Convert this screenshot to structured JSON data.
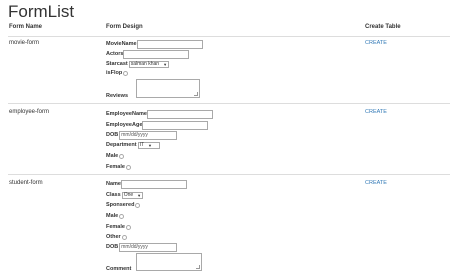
{
  "page": {
    "title": "FormList"
  },
  "table": {
    "headers": {
      "name": "Form Name",
      "design": "Form Design",
      "create": "Create Table"
    }
  },
  "forms": {
    "movie": {
      "name": "movie-form",
      "create_label": "CREATE",
      "fields": {
        "moviename": {
          "label": "MovieName"
        },
        "actors": {
          "label": "Actors"
        },
        "starcast": {
          "label": "Starcast",
          "selected": "salman khan"
        },
        "isflop": {
          "label": "isFlop"
        },
        "reviews": {
          "label": "Reviews"
        }
      }
    },
    "employee": {
      "name": "employee-form",
      "create_label": "CREATE",
      "fields": {
        "employeename": {
          "label": "EmployeeName"
        },
        "employeeage": {
          "label": "EmployeeAge"
        },
        "dob": {
          "label": "DOB",
          "placeholder": "mm/dd/yyyy"
        },
        "department": {
          "label": "Department",
          "selected": "IT"
        },
        "male": {
          "label": "Male"
        },
        "female": {
          "label": "Female"
        }
      }
    },
    "student": {
      "name": "student-form",
      "create_label": "CREATE",
      "fields": {
        "name": {
          "label": "Name"
        },
        "class": {
          "label": "Class",
          "selected": "One"
        },
        "sponsered": {
          "label": "Sponsered"
        },
        "male": {
          "label": "Male"
        },
        "female": {
          "label": "Female"
        },
        "other": {
          "label": "Other"
        },
        "dob": {
          "label": "DOB",
          "placeholder": "mm/dd/yyyy"
        },
        "comment": {
          "label": "Comment"
        }
      }
    }
  },
  "icons": {
    "dropdown": "chevron-down-icon",
    "radio": "radio-button-icon",
    "resize": "resize-handle-icon"
  },
  "colors": {
    "link": "#337ab7",
    "border": "#dddddd",
    "text": "#333333"
  }
}
